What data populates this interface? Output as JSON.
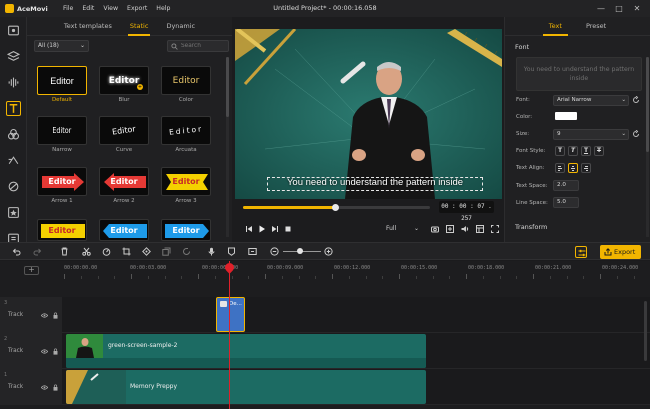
{
  "app": {
    "name": "AceMovi",
    "menus": [
      "File",
      "Edit",
      "View",
      "Export",
      "Help"
    ],
    "title": "Untitled Project* - 00:00:16.058"
  },
  "window_controls": {
    "minimize": "—",
    "maximize": "□",
    "close": "✕"
  },
  "left_tools": [
    {
      "name": "media-icon"
    },
    {
      "name": "layers-icon"
    },
    {
      "name": "audio-icon"
    },
    {
      "name": "text-icon",
      "active": true
    },
    {
      "name": "filters-icon"
    },
    {
      "name": "transitions-icon"
    },
    {
      "name": "overlays-icon"
    },
    {
      "name": "elements-icon"
    },
    {
      "name": "music-icon"
    }
  ],
  "assets": {
    "tabs": [
      {
        "label": "Text templates"
      },
      {
        "label": "Static",
        "active": true
      },
      {
        "label": "Dynamic"
      }
    ],
    "filter": "All (18)",
    "search_placeholder": "Search",
    "items": [
      {
        "caption": "Default",
        "text": "Editor",
        "selected": true
      },
      {
        "caption": "Blur",
        "text": "Editor"
      },
      {
        "caption": "Color",
        "text": "Editor"
      },
      {
        "caption": "Narrow",
        "text": "Editor"
      },
      {
        "caption": "Curve",
        "text": "Editor"
      },
      {
        "caption": "Arcuata",
        "text": "Editor"
      },
      {
        "caption": "Arrow 1",
        "text": "Editor"
      },
      {
        "caption": "Arrow 2",
        "text": "Editor"
      },
      {
        "caption": "Arrow 3",
        "text": "Editor"
      },
      {
        "caption": "",
        "text": "Editor"
      },
      {
        "caption": "",
        "text": "Editor"
      },
      {
        "caption": "",
        "text": "Editor"
      }
    ]
  },
  "preview": {
    "caption": "You need to understand the pattern inside",
    "timecode": "00 : 00 : 07 . 257",
    "progress": 0.49,
    "quality": "Full"
  },
  "properties": {
    "tabs": [
      {
        "label": "Text",
        "active": true
      },
      {
        "label": "Preset"
      }
    ],
    "font_section": "Font",
    "text_value": "You need to understand the pattern inside",
    "font_label": "Font:",
    "font_value": "Arial Narrow",
    "color_label": "Color:",
    "color_value": "#ffffff",
    "size_label": "Size:",
    "size_value": "9",
    "style_label": "Font Style:",
    "style_buttons": [
      "T",
      "T",
      "T",
      "T"
    ],
    "align_label": "Text Align:",
    "text_space_label": "Text Space:",
    "text_space_value": "2.0",
    "line_space_label": "Line Space:",
    "line_space_value": "5.0",
    "transform_section": "Transform"
  },
  "toolbar": {
    "export_label": "Export"
  },
  "timeline": {
    "add_track": "+",
    "ruler": [
      "00:00:00.00",
      "00:00:03.000",
      "00:00:06.000",
      "00:00:09.000",
      "00:00:12.000",
      "00:00:15.000",
      "00:00:18.000",
      "00:00:21.000",
      "00:00:24.000"
    ],
    "tracks": [
      {
        "number": "3",
        "name": "Track"
      },
      {
        "number": "2",
        "name": "Track"
      },
      {
        "number": "1",
        "name": "Track"
      }
    ],
    "clips": {
      "text_clip": "De...",
      "video_clip_1": "green-screen-sample-2",
      "video_clip_2": "Memory Preppy"
    }
  }
}
